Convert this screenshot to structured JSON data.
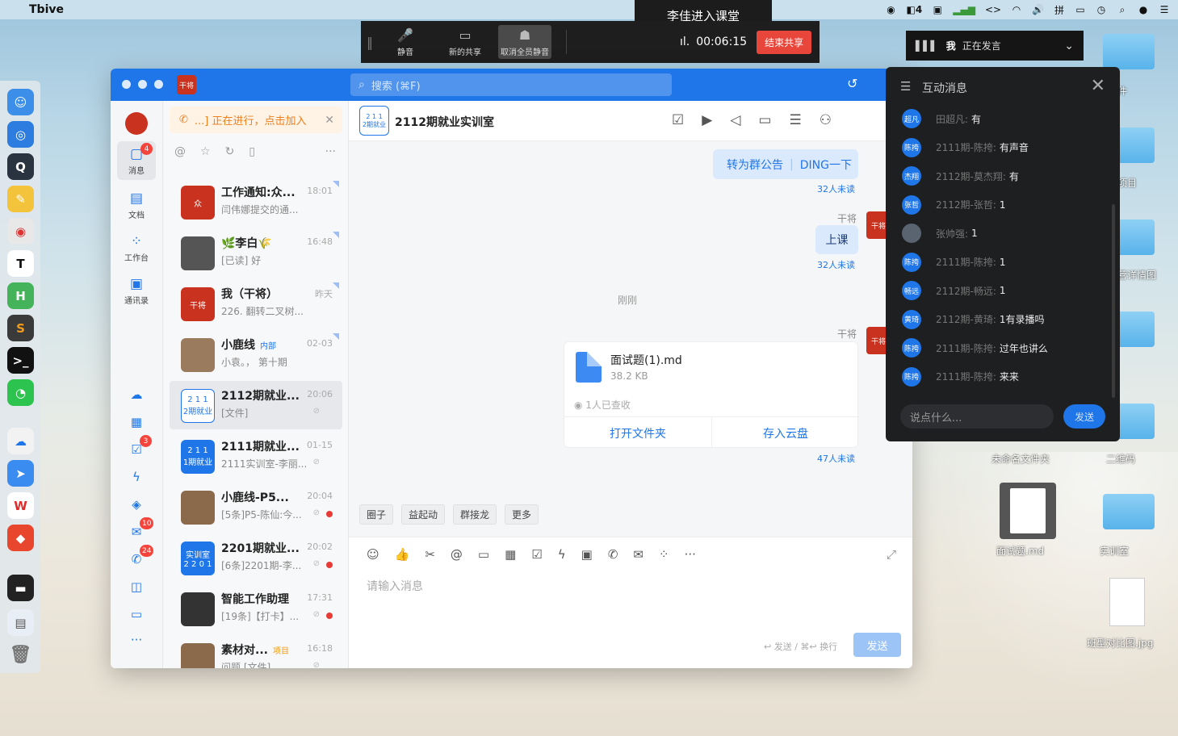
{
  "menubar": {
    "app_name": "Tbive",
    "tray_icons": [
      "stop-icon",
      "vpn-icon",
      "wechat-icon",
      "signal-icon",
      "code-icon",
      "wifi-icon",
      "volume-icon",
      "input-method-icon",
      "battery-icon",
      "clock-icon",
      "search-icon",
      "siri-icon",
      "menu-icon"
    ],
    "tray_count": "4",
    "input_method": "拼"
  },
  "notification": "李佳进入课堂",
  "meeting": {
    "tools": [
      {
        "label": "静音",
        "icon": "mic-icon"
      },
      {
        "label": "新的共享",
        "icon": "share-icon"
      },
      {
        "label": "取消全员静音",
        "icon": "users-mute-icon"
      }
    ],
    "timer": "00:06:15",
    "end_label": "结束共享"
  },
  "speaker": {
    "name": "我",
    "status": "正在发言"
  },
  "desktop": {
    "labels": [
      "件",
      "项目",
      "营详情图",
      "二维码",
      "未命名文件夹",
      "面试题.md",
      "实训室",
      "班型对比图.jpg"
    ]
  },
  "window": {
    "search_placeholder": "搜索 (⌘F)",
    "logo_text": "干将"
  },
  "nav": {
    "items": [
      {
        "label": "消息",
        "badge": "4"
      },
      {
        "label": "文档"
      },
      {
        "label": "工作台"
      },
      {
        "label": "通讯录"
      }
    ],
    "more": "···",
    "badges": {
      "todo": "3",
      "mail": "10",
      "phone": "24"
    }
  },
  "conv": {
    "ongoing": "...] 正在进行，点击加入",
    "items": [
      {
        "name": "工作通知:众...",
        "time": "18:01",
        "preview": "闫伟娜提交的通...",
        "avatar": "众"
      },
      {
        "name": "🌿李白🌾",
        "time": "16:48",
        "preview": "[已读] 好",
        "avatar": ""
      },
      {
        "name": "我（干将）",
        "time": "昨天",
        "preview": "226. 翻转二叉树...",
        "avatar": "干将"
      },
      {
        "name": "小鹿线",
        "tag": "内部",
        "time": "02-03",
        "preview": "小袁。，  第十期",
        "avatar": ""
      },
      {
        "name": "2112期就业...",
        "time": "20:06",
        "preview": "[文件]",
        "avatar": "2 1 1\n2期就业"
      },
      {
        "name": "2111期就业...",
        "time": "01-15",
        "preview": "2111实训室-李丽...",
        "avatar": "2 1 1\n1期就业"
      },
      {
        "name": "小鹿线-P5...",
        "time": "20:04",
        "preview": "[5条]P5-陈仙:今...",
        "avatar": ""
      },
      {
        "name": "2201期就业...",
        "time": "20:02",
        "preview": "[6条]2201期-李...",
        "avatar": "实训室\n2 2 0 1"
      },
      {
        "name": "智能工作助理",
        "time": "17:31",
        "preview": "[19条]【打卡】...",
        "avatar": ""
      },
      {
        "name": "素材对...",
        "tag": "项目",
        "time": "16:18",
        "preview": "问题 [文件]",
        "avatar": ""
      }
    ]
  },
  "chat": {
    "group_avatar": "2 1 1\n2期就业",
    "group_name": "2112期就业实训室",
    "announce_btn": "转为群公告",
    "ding_btn": "DING一下",
    "unread1": "32人未读",
    "sender": "干将",
    "msg1": "上课",
    "unread2": "32人未读",
    "time_divider": "刚刚",
    "file": {
      "name": "面试题(1).md",
      "size": "38.2 KB",
      "read": "1人已查收",
      "open": "打开文件夹",
      "save": "存入云盘"
    },
    "unread3": "47人未读",
    "avatar_text": "干将",
    "quick": [
      "圈子",
      "益起动",
      "群接龙",
      "更多"
    ],
    "input_placeholder": "请输入消息",
    "hint": "↩ 发送 / ⌘↩ 换行",
    "send": "发送"
  },
  "panel": {
    "title": "互动消息",
    "messages": [
      {
        "av": "超凡",
        "name": "田超凡:",
        "text": "有"
      },
      {
        "av": "陈挎",
        "name": "2111期-陈挎:",
        "text": "有声音"
      },
      {
        "av": "杰翔",
        "name": "2112期-莫杰翔:",
        "text": "有"
      },
      {
        "av": "张哲",
        "name": "2112期-张哲:",
        "text": "1"
      },
      {
        "av": "",
        "name": "张帅强:",
        "text": "1"
      },
      {
        "av": "陈挎",
        "name": "2111期-陈挎:",
        "text": "1"
      },
      {
        "av": "畅远",
        "name": "2112期-畅远:",
        "text": "1"
      },
      {
        "av": "黄琦",
        "name": "2112期-黄琦:",
        "text": "1有录播吗"
      },
      {
        "av": "陈挎",
        "name": "2111期-陈挎:",
        "text": "过年也讲么"
      },
      {
        "av": "陈挎",
        "name": "2111期-陈挎:",
        "text": "来来"
      }
    ],
    "input_placeholder": "说点什么...",
    "send": "发送"
  },
  "colors": {
    "accent": "#1f76e8",
    "danger": "#e8463b",
    "orange": "#f07f1b"
  }
}
